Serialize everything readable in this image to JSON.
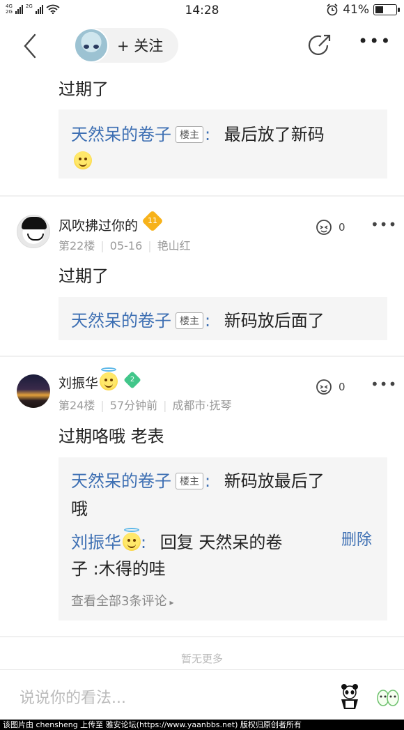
{
  "status_bar": {
    "network_top": "4G",
    "network_bottom": "2G",
    "network_top2": "2G",
    "time": "14:28",
    "battery": "41%",
    "battery_level": 0.41
  },
  "nav": {
    "follow_label": "+ 关注"
  },
  "top_fragment": {
    "text": "过期了",
    "quote": {
      "author": "天然呆的卷子",
      "badge": "楼主",
      "text": "最后放了新码"
    }
  },
  "posts": [
    {
      "username": "风吹拂过你的",
      "badge": "11",
      "floor": "第22楼",
      "date": "05-16",
      "location": "艳山红",
      "likes": "0",
      "text": "过期了",
      "replies": [
        {
          "author": "天然呆的卷子",
          "badge": "楼主",
          "text": "新码放后面了"
        }
      ]
    },
    {
      "username": "刘振华",
      "badge": "2",
      "floor": "第24楼",
      "date": "57分钟前",
      "location": "成都市·抚琴",
      "likes": "0",
      "text": "过期咯哦 老表",
      "replies": [
        {
          "author": "天然呆的卷子",
          "badge": "楼主",
          "text_line1": "新码放最后了",
          "text_line2": "哦"
        },
        {
          "author": "刘振华",
          "text_line1": "回复 天然呆的卷",
          "text_line2": "子 :木得的哇",
          "delete_label": "删除"
        }
      ],
      "view_all": "查看全部3条评论"
    }
  ],
  "no_more": "暂无更多",
  "input": {
    "placeholder": "说说你的看法..."
  },
  "footer": "该图片由 chensheng 上传至 雅安论坛(https://www.yaanbbs.net) 版权归原创者所有",
  "colors": {
    "link_blue": "#3d6fb3",
    "quote_bg": "#f5f5f5",
    "meta_gray": "#999999"
  },
  "icons": [
    "back-icon",
    "share-icon",
    "more-icon",
    "like-icon",
    "alarm-icon",
    "battery-icon",
    "wifi-icon",
    "signal-icon",
    "panda-icon",
    "emoji-icon"
  ]
}
